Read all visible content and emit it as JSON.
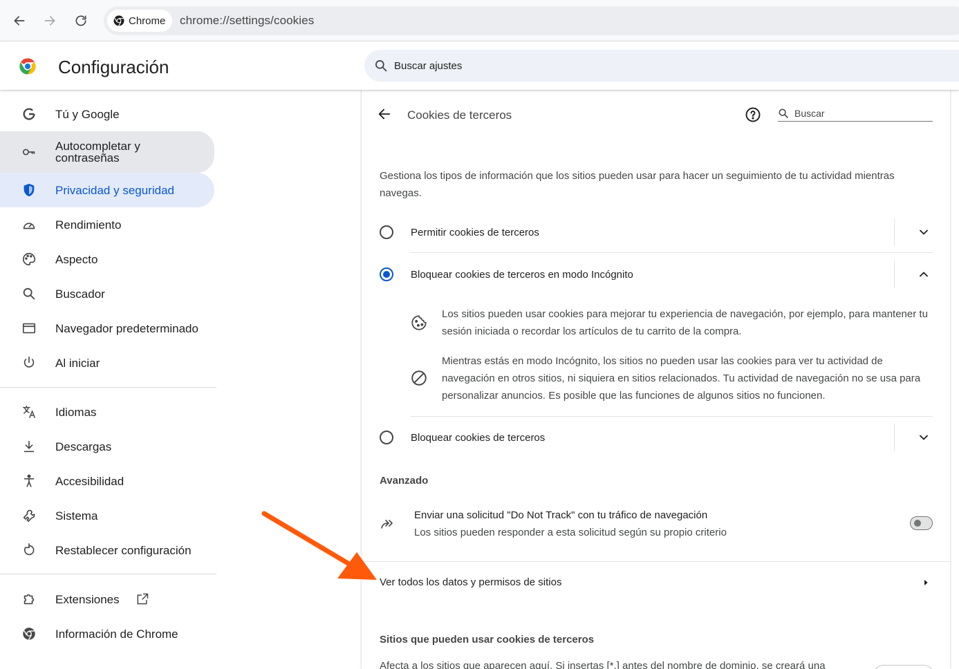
{
  "browser": {
    "back_icon": "arrow-left-icon",
    "forward_icon": "arrow-right-icon",
    "reload_icon": "reload-icon",
    "chip_label": "Chrome",
    "url": "chrome://settings/cookies"
  },
  "header": {
    "title": "Configuración",
    "search_placeholder": "Buscar ajustes"
  },
  "sidebar": {
    "items": [
      {
        "label": "Tú y Google",
        "icon": "google-g-icon"
      },
      {
        "label": "Autocompletar y contraseñas",
        "icon": "key-icon"
      },
      {
        "label": "Privacidad y seguridad",
        "icon": "shield-icon"
      },
      {
        "label": "Rendimiento",
        "icon": "speedometer-icon"
      },
      {
        "label": "Aspecto",
        "icon": "palette-icon"
      },
      {
        "label": "Buscador",
        "icon": "search-icon"
      },
      {
        "label": "Navegador predeterminado",
        "icon": "browser-window-icon"
      },
      {
        "label": "Al iniciar",
        "icon": "power-icon"
      },
      {
        "label": "Idiomas",
        "icon": "translate-icon"
      },
      {
        "label": "Descargas",
        "icon": "download-icon"
      },
      {
        "label": "Accesibilidad",
        "icon": "accessibility-icon"
      },
      {
        "label": "Sistema",
        "icon": "wrench-icon"
      },
      {
        "label": "Restablecer configuración",
        "icon": "reset-icon"
      },
      {
        "label": "Extensiones",
        "icon": "puzzle-icon"
      },
      {
        "label": "Información de Chrome",
        "icon": "chrome-logo-icon"
      }
    ],
    "active_item": "Privacidad y seguridad"
  },
  "main": {
    "subpage_title": "Cookies de terceros",
    "search_placeholder": "Buscar",
    "description": "Gestiona los tipos de información que los sitios pueden usar para hacer un seguimiento de tu actividad mientras navegas.",
    "options": [
      {
        "label": "Permitir cookies de terceros",
        "checked": false,
        "expanded": false
      },
      {
        "label": "Bloquear cookies de terceros en modo Incógnito",
        "checked": true,
        "expanded": true
      },
      {
        "label": "Bloquear cookies de terceros",
        "checked": false,
        "expanded": false
      }
    ],
    "expanded_details": [
      {
        "icon": "cookie-icon",
        "text": "Los sitios pueden usar cookies para mejorar tu experiencia de navegación, por ejemplo, para mantener tu sesión iniciada o recordar los artículos de tu carrito de la compra."
      },
      {
        "icon": "block-icon",
        "text": "Mientras estás en modo Incógnito, los sitios no pueden usar las cookies para ver tu actividad de navegación en otros sitios, ni siquiera en sitios relacionados. Tu actividad de navegación no se usa para personalizar anuncios. Es posible que las funciones de algunos sitios no funcionen."
      }
    ],
    "advanced_title": "Avanzado",
    "dnt": {
      "label": "Enviar una solicitud \"Do Not Track\" con tu tráfico de navegación",
      "sublabel": "Los sitios pueden responder a esta solicitud según su propio criterio",
      "enabled": false
    },
    "site_data_link": "Ver todos los datos y permisos de sitios",
    "allowed_sites_title": "Sitios que pueden usar cookies de terceros",
    "allowed_sites_desc": "Afecta a los sitios que aparecen aquí. Si insertas [*.] antes del nombre de dominio, se creará una"
  },
  "colors": {
    "accent": "#0b57d0",
    "active_bg": "#e3ebfb",
    "annotation_arrow": "#ff5a0a"
  }
}
